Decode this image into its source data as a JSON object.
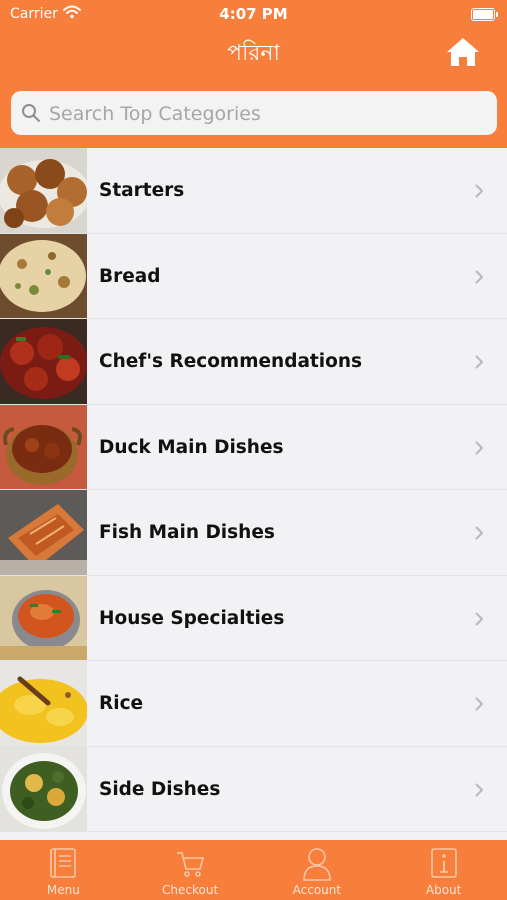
{
  "status_bar": {
    "carrier": "Carrier",
    "time": "4:07 PM"
  },
  "header": {
    "logo_text": "পরিনা"
  },
  "search": {
    "placeholder": "Search Top Categories",
    "value": ""
  },
  "categories": [
    {
      "label": "Starters"
    },
    {
      "label": "Bread"
    },
    {
      "label": "Chef's Recommendations"
    },
    {
      "label": "Duck Main Dishes"
    },
    {
      "label": "Fish Main Dishes"
    },
    {
      "label": "House Specialties"
    },
    {
      "label": "Rice"
    },
    {
      "label": "Side Dishes"
    }
  ],
  "tabbar": {
    "menu": "Menu",
    "checkout": "Checkout",
    "account": "Account",
    "about": "About"
  },
  "colors": {
    "accent": "#f77e3b",
    "list_bg": "#f2f2f4"
  },
  "icons": [
    "wifi-icon",
    "battery-icon",
    "home-icon",
    "search-icon",
    "chevron-right-icon",
    "menu-book-icon",
    "cart-icon",
    "user-icon",
    "info-icon"
  ]
}
